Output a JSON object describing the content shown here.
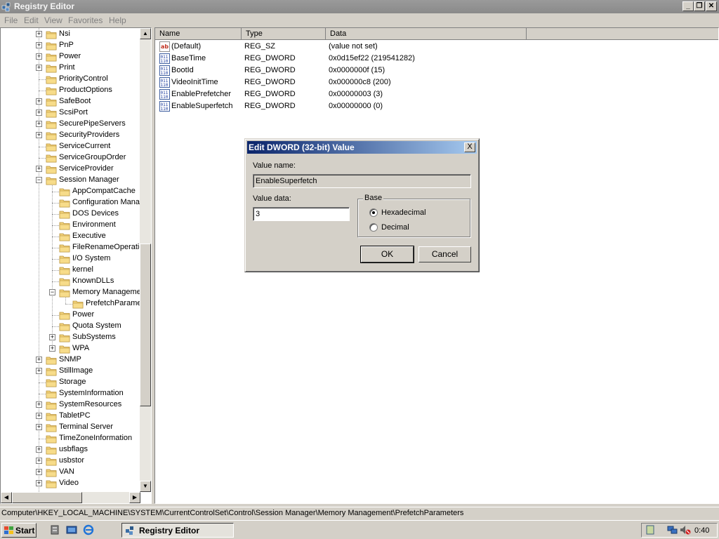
{
  "window": {
    "title": "Registry Editor"
  },
  "menu": [
    "File",
    "Edit",
    "View",
    "Favorites",
    "Help"
  ],
  "tree": {
    "items": [
      {
        "label": "Nsi",
        "indent": 0,
        "expander": "+"
      },
      {
        "label": "PnP",
        "indent": 0,
        "expander": "+"
      },
      {
        "label": "Power",
        "indent": 0,
        "expander": "+"
      },
      {
        "label": "Print",
        "indent": 0,
        "expander": "+"
      },
      {
        "label": "PriorityControl",
        "indent": 0,
        "expander": ""
      },
      {
        "label": "ProductOptions",
        "indent": 0,
        "expander": ""
      },
      {
        "label": "SafeBoot",
        "indent": 0,
        "expander": "+"
      },
      {
        "label": "ScsiPort",
        "indent": 0,
        "expander": "+"
      },
      {
        "label": "SecurePipeServers",
        "indent": 0,
        "expander": "+"
      },
      {
        "label": "SecurityProviders",
        "indent": 0,
        "expander": "+"
      },
      {
        "label": "ServiceCurrent",
        "indent": 0,
        "expander": ""
      },
      {
        "label": "ServiceGroupOrder",
        "indent": 0,
        "expander": ""
      },
      {
        "label": "ServiceProvider",
        "indent": 0,
        "expander": "+"
      },
      {
        "label": "Session Manager",
        "indent": 0,
        "expander": "-"
      },
      {
        "label": "AppCompatCache",
        "indent": 1,
        "expander": ""
      },
      {
        "label": "Configuration Mana",
        "indent": 1,
        "expander": ""
      },
      {
        "label": "DOS Devices",
        "indent": 1,
        "expander": ""
      },
      {
        "label": "Environment",
        "indent": 1,
        "expander": ""
      },
      {
        "label": "Executive",
        "indent": 1,
        "expander": ""
      },
      {
        "label": "FileRenameOperatio",
        "indent": 1,
        "expander": ""
      },
      {
        "label": "I/O System",
        "indent": 1,
        "expander": ""
      },
      {
        "label": "kernel",
        "indent": 1,
        "expander": ""
      },
      {
        "label": "KnownDLLs",
        "indent": 1,
        "expander": ""
      },
      {
        "label": "Memory Manageme",
        "indent": 1,
        "expander": "-"
      },
      {
        "label": "PrefetchParame",
        "indent": 2,
        "expander": ""
      },
      {
        "label": "Power",
        "indent": 1,
        "expander": ""
      },
      {
        "label": "Quota System",
        "indent": 1,
        "expander": ""
      },
      {
        "label": "SubSystems",
        "indent": 1,
        "expander": "+"
      },
      {
        "label": "WPA",
        "indent": 1,
        "expander": "+"
      },
      {
        "label": "SNMP",
        "indent": 0,
        "expander": "+"
      },
      {
        "label": "StillImage",
        "indent": 0,
        "expander": "+"
      },
      {
        "label": "Storage",
        "indent": 0,
        "expander": ""
      },
      {
        "label": "SystemInformation",
        "indent": 0,
        "expander": ""
      },
      {
        "label": "SystemResources",
        "indent": 0,
        "expander": "+"
      },
      {
        "label": "TabletPC",
        "indent": 0,
        "expander": "+"
      },
      {
        "label": "Terminal Server",
        "indent": 0,
        "expander": "+"
      },
      {
        "label": "TimeZoneInformation",
        "indent": 0,
        "expander": ""
      },
      {
        "label": "usbflags",
        "indent": 0,
        "expander": "+"
      },
      {
        "label": "usbstor",
        "indent": 0,
        "expander": "+"
      },
      {
        "label": "VAN",
        "indent": 0,
        "expander": "+"
      },
      {
        "label": "Video",
        "indent": 0,
        "expander": "+"
      }
    ]
  },
  "list": {
    "columns": [
      "Name",
      "Type",
      "Data"
    ],
    "rows": [
      {
        "icon": "string-value-icon",
        "name": "(Default)",
        "type": "REG_SZ",
        "data": "(value not set)"
      },
      {
        "icon": "binary-value-icon",
        "name": "BaseTime",
        "type": "REG_DWORD",
        "data": "0x0d15ef22 (219541282)"
      },
      {
        "icon": "binary-value-icon",
        "name": "BootId",
        "type": "REG_DWORD",
        "data": "0x0000000f (15)"
      },
      {
        "icon": "binary-value-icon",
        "name": "VideoInitTime",
        "type": "REG_DWORD",
        "data": "0x000000c8 (200)"
      },
      {
        "icon": "binary-value-icon",
        "name": "EnablePrefetcher",
        "type": "REG_DWORD",
        "data": "0x00000003 (3)"
      },
      {
        "icon": "binary-value-icon",
        "name": "EnableSuperfetch",
        "type": "REG_DWORD",
        "data": "0x00000000 (0)"
      }
    ]
  },
  "statusbar": {
    "path": "Computer\\HKEY_LOCAL_MACHINE\\SYSTEM\\CurrentControlSet\\Control\\Session Manager\\Memory Management\\PrefetchParameters"
  },
  "taskbar": {
    "start_label": "Start",
    "task_label": "Registry Editor",
    "clock": "0:40"
  },
  "dialog": {
    "title": "Edit DWORD (32-bit) Value",
    "close_label": "X",
    "value_name_label": "Value name:",
    "value_name": "EnableSuperfetch",
    "value_data_label": "Value data:",
    "value_data": "3",
    "base_label": "Base",
    "hex_label": "Hexadecimal",
    "dec_label": "Decimal",
    "selected_base": "Hexadecimal",
    "ok_label": "OK",
    "cancel_label": "Cancel"
  }
}
